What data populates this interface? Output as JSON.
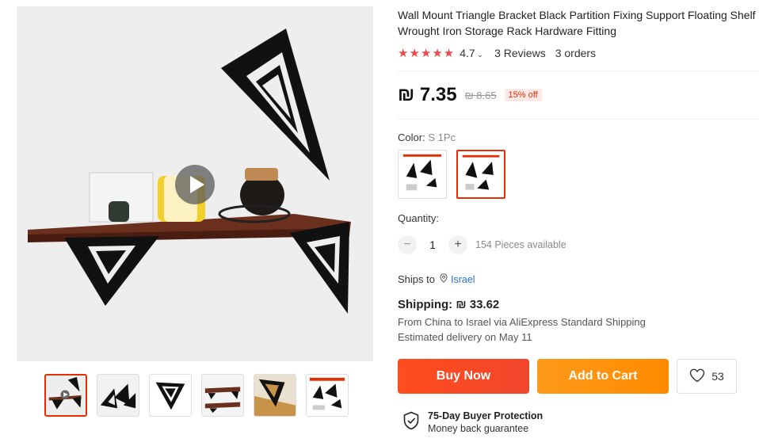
{
  "product": {
    "title": "Wall Mount Triangle Bracket Black Partition Fixing Support Floating Shelf Wrought Iron Storage Rack Hardware Fitting",
    "stars": "★★★★★",
    "rating": "4.7",
    "reviews": "3 Reviews",
    "orders": "3 orders"
  },
  "price": {
    "current": "₪ 7.35",
    "original": "₪ 8.65",
    "discount": "15% off"
  },
  "color": {
    "label": "Color:",
    "selected": "S 1Pc"
  },
  "quantity": {
    "label": "Quantity:",
    "value": "1",
    "minus": "−",
    "plus": "+",
    "available": "154 Pieces available"
  },
  "ships_to": {
    "label": "Ships to",
    "country": "Israel"
  },
  "shipping": {
    "cost": "Shipping: ₪ 33.62",
    "route": "From China to Israel via AliExpress Standard Shipping",
    "delivery": "Estimated delivery on May 11"
  },
  "actions": {
    "buy_now": "Buy Now",
    "add_to_cart": "Add to Cart",
    "wishlist_count": "53"
  },
  "protection": {
    "title": "75-Day Buyer Protection",
    "subtitle": "Money back guarantee"
  },
  "icons": {
    "star": "star-icon",
    "chevron": "chevron-down-icon",
    "pin": "location-pin-icon",
    "heart": "heart-icon",
    "shield": "shield-check-icon",
    "play": "play-icon"
  },
  "colors": {
    "accent": "#e62e04",
    "buy": "#f0462c",
    "cart": "#ff8a00",
    "star": "#f0484b",
    "link": "#2e6fce"
  }
}
